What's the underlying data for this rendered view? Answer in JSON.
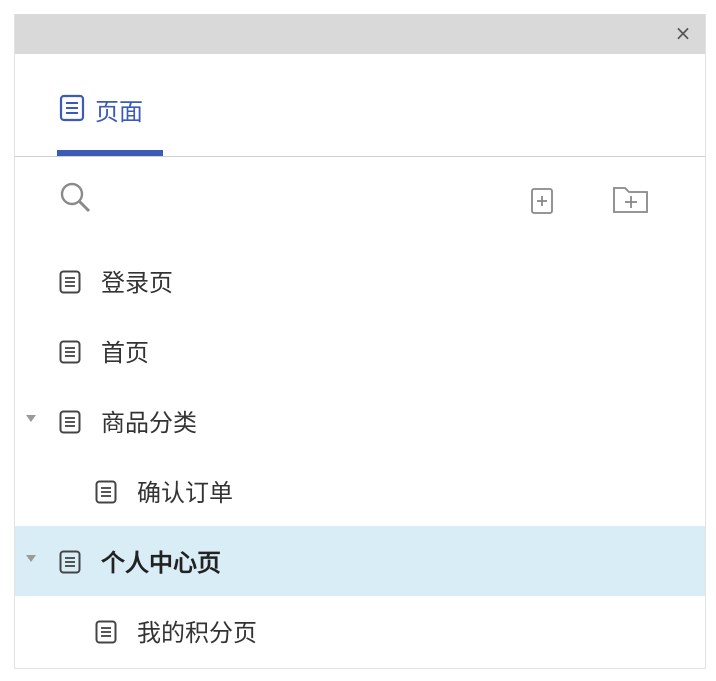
{
  "window": {
    "close_label": "×"
  },
  "tabs": [
    {
      "label": "页面"
    }
  ],
  "tree": [
    {
      "label": "登录页"
    },
    {
      "label": "首页"
    },
    {
      "label": "商品分类"
    },
    {
      "label": "确认订单"
    },
    {
      "label": "个人中心页"
    },
    {
      "label": "我的积分页"
    }
  ],
  "colors": {
    "accent": "#3b5bb5",
    "selected_bg": "#d8edf6",
    "titlebar": "#d9d9d9"
  }
}
